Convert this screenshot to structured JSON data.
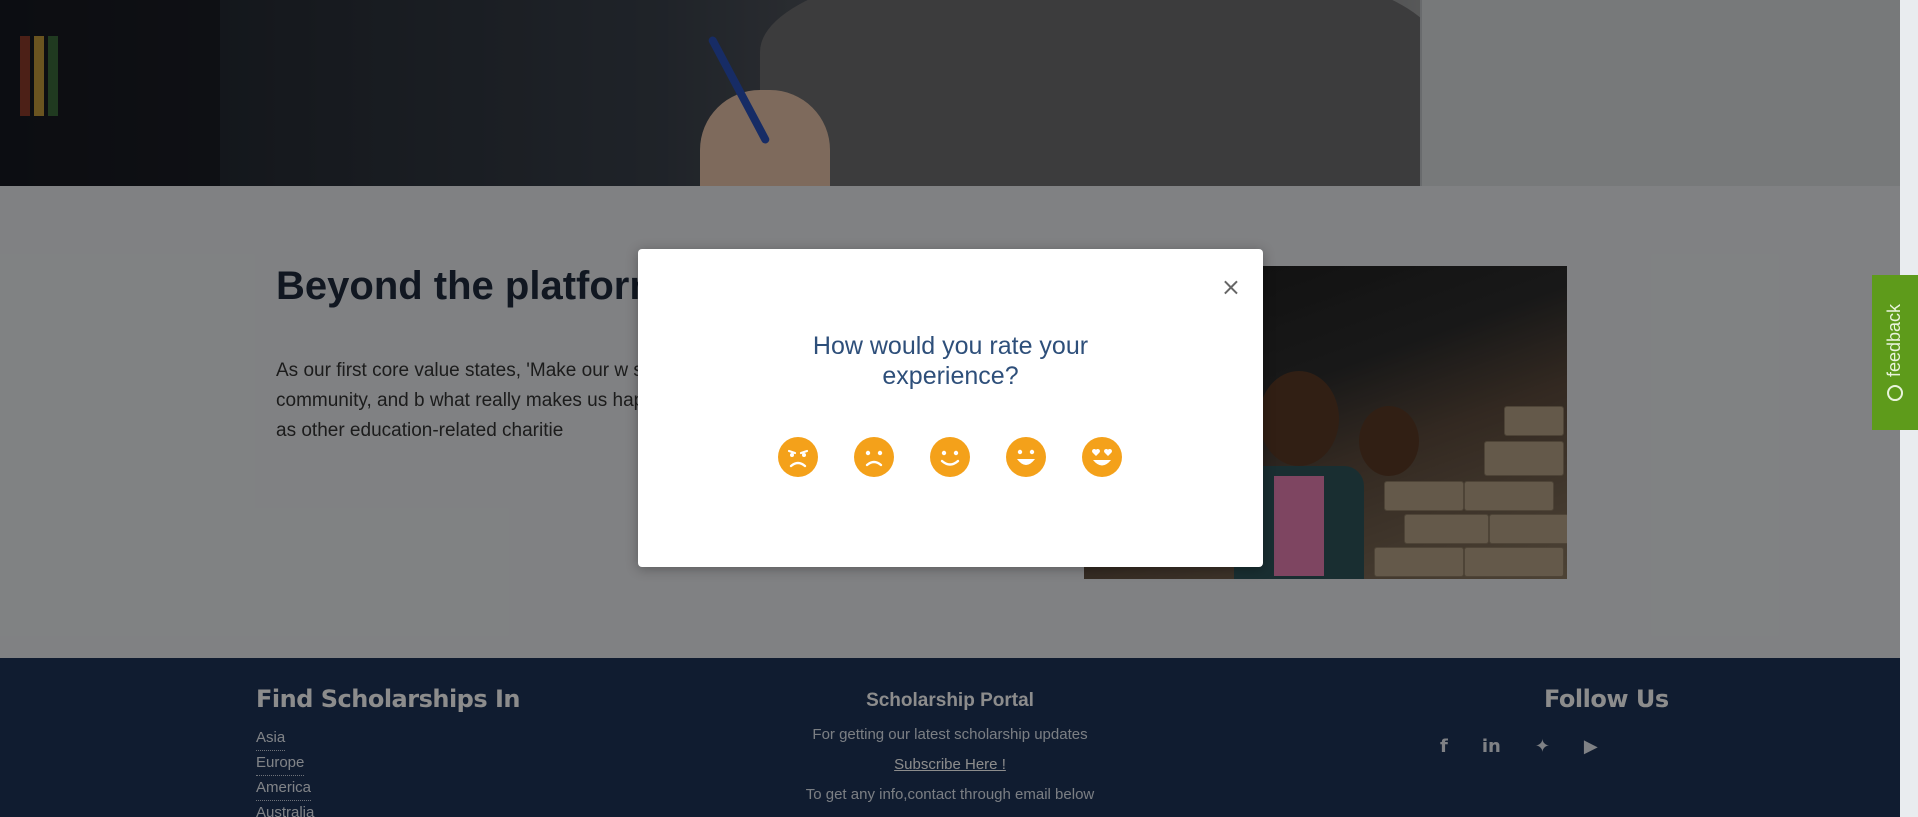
{
  "content": {
    "heading": "Beyond the platform",
    "paragraph": "As our first core value states, 'Make our w something back to the community, and b what really makes us happy. Currently, Stu as well as other education-related charitie"
  },
  "footer": {
    "find_title": "Find Scholarships In",
    "regions": [
      "Asia",
      "Europe",
      "America",
      "Australia"
    ],
    "portal_title": "Scholarship Portal",
    "portal_line1": "For getting our latest scholarship updates",
    "subscribe": "Subscribe Here !",
    "portal_line2": "To get any info,contact through email below",
    "follow_title": "Follow Us",
    "socials": [
      "f",
      "in",
      "✦",
      "▶"
    ]
  },
  "feedback_tab": {
    "label": "feedback"
  },
  "modal": {
    "question": "How would you rate your experience?",
    "close_label": "×",
    "ratings": [
      "very-bad",
      "bad",
      "ok",
      "good",
      "great"
    ]
  },
  "colors": {
    "footer_bg": "#1e3358",
    "accent_orange": "#f4a11a",
    "feedback_green": "#5e9b1b",
    "question_blue": "#2e4f7a"
  }
}
